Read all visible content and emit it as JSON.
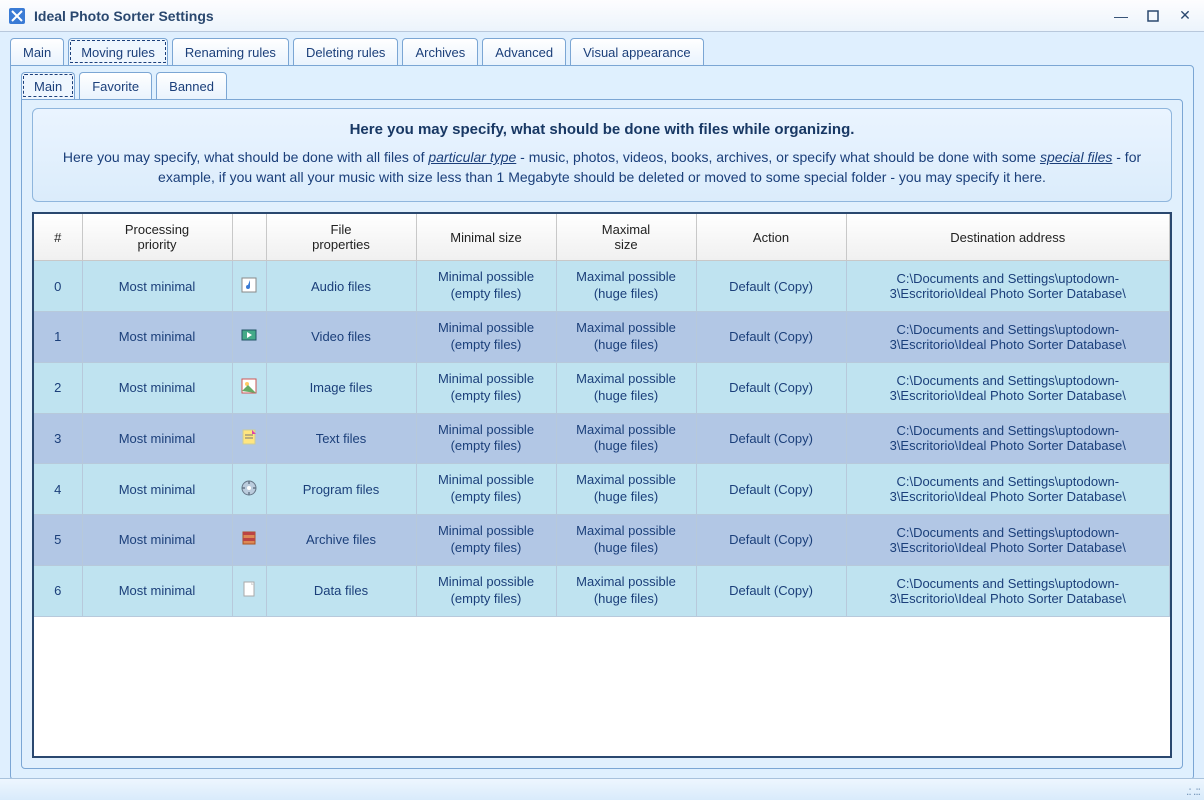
{
  "window": {
    "title": "Ideal Photo Sorter Settings"
  },
  "outer_tabs": [
    "Main",
    "Moving rules",
    "Renaming rules",
    "Deleting rules",
    "Archives",
    "Advanced",
    "Visual appearance"
  ],
  "outer_active_index": 1,
  "inner_tabs": [
    "Main",
    "Favorite",
    "Banned"
  ],
  "inner_active_index": 0,
  "info": {
    "heading": "Here you may specify, what should be done with files while organizing.",
    "line1_a": "Here you may specify, what should be done with all files of ",
    "emph1": "particular type",
    "line1_b": " - music, photos, videos, books, archives, or specify what should be done with some ",
    "emph2": "special files",
    "line1_c": " - for example, if you want all your music with size less than 1 Megabyte should be deleted or moved to some special folder - you may specify it here."
  },
  "columns": [
    "#",
    "Processing priority",
    "",
    "File properties",
    "Minimal size",
    "Maximal size",
    "Action",
    "Destination address"
  ],
  "min_cell": {
    "l1": "Minimal possible",
    "l2": "(empty files)"
  },
  "max_cell": {
    "l1": "Maximal possible",
    "l2": "(huge files)"
  },
  "rows": [
    {
      "n": "0",
      "prio": "Most minimal",
      "icon": "audio",
      "ftype": "Audio files",
      "action": "Default (Copy)",
      "dest": "C:\\Documents and Settings\\uptodown-3\\Escritorio\\Ideal Photo Sorter Database\\"
    },
    {
      "n": "1",
      "prio": "Most minimal",
      "icon": "video",
      "ftype": "Video files",
      "action": "Default (Copy)",
      "dest": "C:\\Documents and Settings\\uptodown-3\\Escritorio\\Ideal Photo Sorter Database\\"
    },
    {
      "n": "2",
      "prio": "Most minimal",
      "icon": "image",
      "ftype": "Image files",
      "action": "Default (Copy)",
      "dest": "C:\\Documents and Settings\\uptodown-3\\Escritorio\\Ideal Photo Sorter Database\\"
    },
    {
      "n": "3",
      "prio": "Most minimal",
      "icon": "text",
      "ftype": "Text files",
      "action": "Default (Copy)",
      "dest": "C:\\Documents and Settings\\uptodown-3\\Escritorio\\Ideal Photo Sorter Database\\"
    },
    {
      "n": "4",
      "prio": "Most minimal",
      "icon": "program",
      "ftype": "Program files",
      "action": "Default (Copy)",
      "dest": "C:\\Documents and Settings\\uptodown-3\\Escritorio\\Ideal Photo Sorter Database\\"
    },
    {
      "n": "5",
      "prio": "Most minimal",
      "icon": "archive",
      "ftype": "Archive files",
      "action": "Default (Copy)",
      "dest": "C:\\Documents and Settings\\uptodown-3\\Escritorio\\Ideal Photo Sorter Database\\"
    },
    {
      "n": "6",
      "prio": "Most minimal",
      "icon": "data",
      "ftype": "Data files",
      "action": "Default (Copy)",
      "dest": "C:\\Documents and Settings\\uptodown-3\\Escritorio\\Ideal Photo Sorter Database\\"
    }
  ]
}
